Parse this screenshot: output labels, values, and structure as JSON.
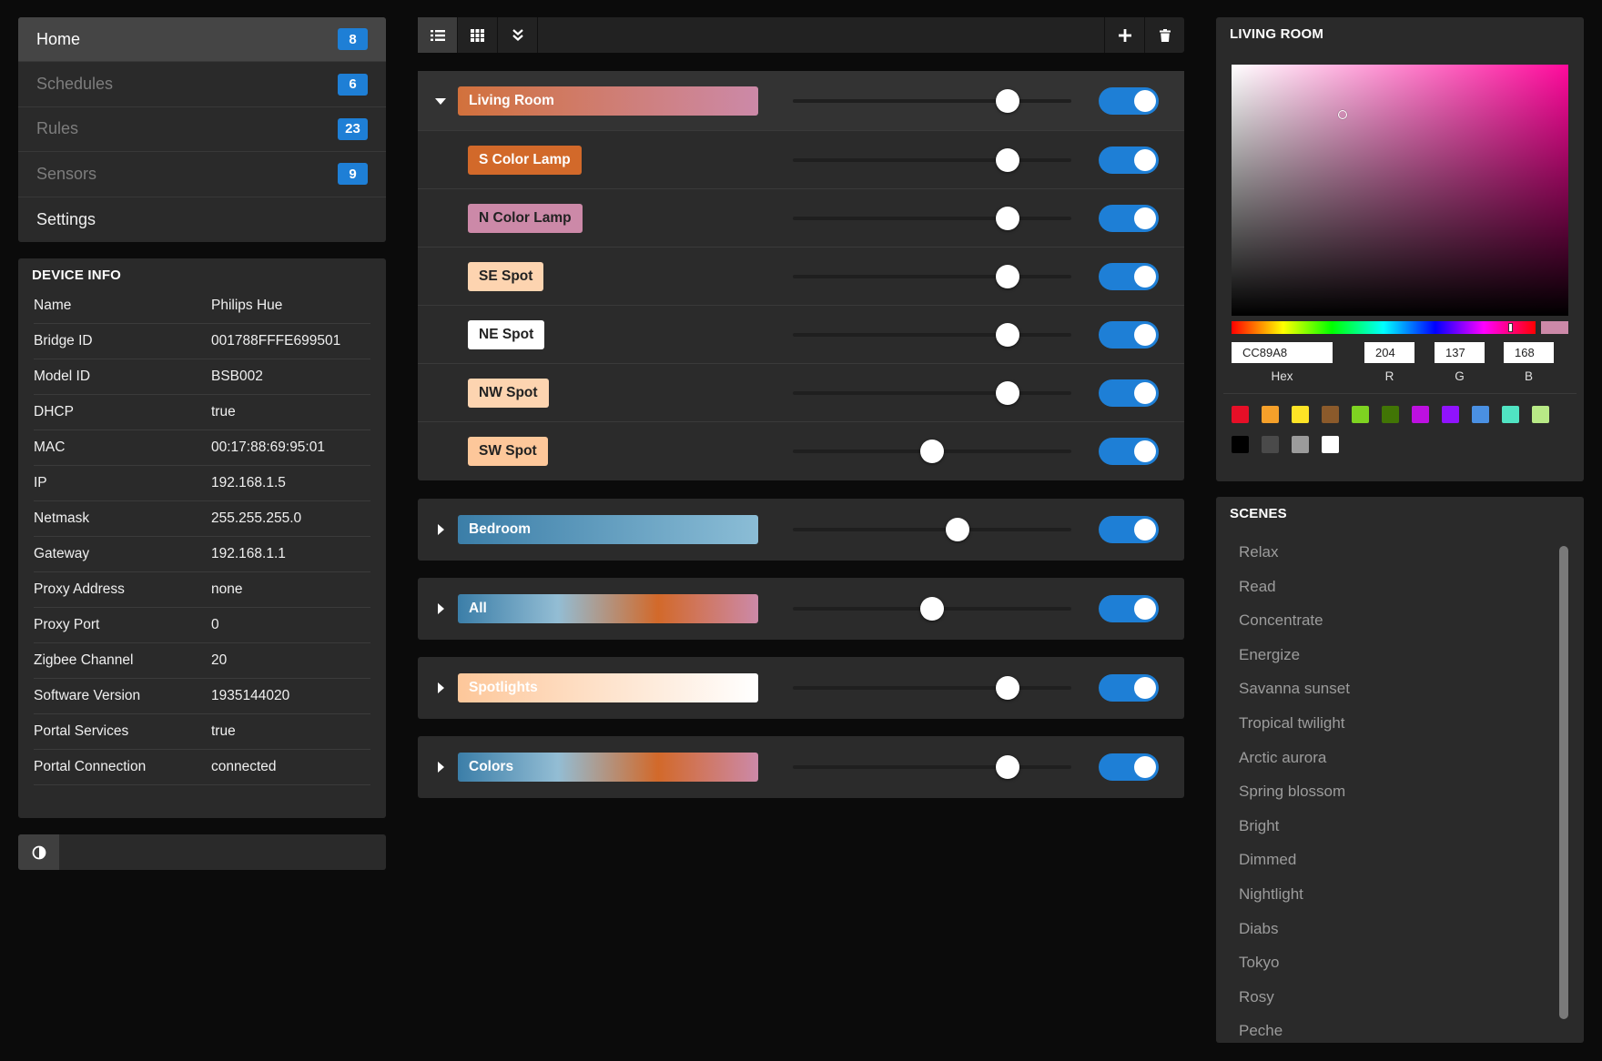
{
  "nav": {
    "items": [
      {
        "label": "Home",
        "badge": "8"
      },
      {
        "label": "Schedules",
        "badge": "6"
      },
      {
        "label": "Rules",
        "badge": "23"
      },
      {
        "label": "Sensors",
        "badge": "9"
      },
      {
        "label": "Settings"
      }
    ]
  },
  "device_info": {
    "title": "DEVICE INFO",
    "rows": [
      {
        "key": "Name",
        "value": "Philips Hue"
      },
      {
        "key": "Bridge ID",
        "value": "001788FFFE699501"
      },
      {
        "key": "Model ID",
        "value": "BSB002"
      },
      {
        "key": "DHCP",
        "value": "true"
      },
      {
        "key": "MAC",
        "value": "00:17:88:69:95:01"
      },
      {
        "key": "IP",
        "value": "192.168.1.5"
      },
      {
        "key": "Netmask",
        "value": "255.255.255.0"
      },
      {
        "key": "Gateway",
        "value": "192.168.1.1"
      },
      {
        "key": "Proxy Address",
        "value": "none"
      },
      {
        "key": "Proxy Port",
        "value": "0"
      },
      {
        "key": "Zigbee Channel",
        "value": "20"
      },
      {
        "key": "Software Version",
        "value": "1935144020"
      },
      {
        "key": "Portal Services",
        "value": "true"
      },
      {
        "key": "Portal Connection",
        "value": "connected"
      }
    ]
  },
  "groups": [
    {
      "name": "Living Room",
      "expanded": true,
      "brightness": 0.77,
      "on": true,
      "gradient": [
        "#d2713c",
        "#cc89a8"
      ],
      "lights": [
        {
          "name": "S Color Lamp",
          "brightness": 0.77,
          "on": true,
          "bg": "#d2692a",
          "fg": "#ffffff"
        },
        {
          "name": "N Color Lamp",
          "brightness": 0.77,
          "on": true,
          "bg": "#cc89a8",
          "fg": "#222222"
        },
        {
          "name": "SE Spot",
          "brightness": 0.77,
          "on": true,
          "bg": "#fdd4b0",
          "fg": "#222222"
        },
        {
          "name": "NE Spot",
          "brightness": 0.77,
          "on": true,
          "bg": "#ffffff",
          "fg": "#222222"
        },
        {
          "name": "NW Spot",
          "brightness": 0.77,
          "on": true,
          "bg": "#fdd4b0",
          "fg": "#222222"
        },
        {
          "name": "SW Spot",
          "brightness": 0.5,
          "on": true,
          "bg": "#fdc79a",
          "fg": "#222222"
        }
      ]
    },
    {
      "name": "Bedroom",
      "expanded": false,
      "brightness": 0.59,
      "on": true,
      "gradient": [
        "#3b7ea8",
        "#8bbdd6"
      ]
    },
    {
      "name": "All",
      "expanded": false,
      "brightness": 0.5,
      "on": true,
      "gradient": [
        "#3b7ea8",
        "#93bdd4",
        "#d2692a",
        "#cc89a8"
      ]
    },
    {
      "name": "Spotlights",
      "expanded": false,
      "brightness": 0.77,
      "on": true,
      "gradient": [
        "#fdc79a",
        "#ffffff"
      ]
    },
    {
      "name": "Colors",
      "expanded": false,
      "brightness": 0.77,
      "on": true,
      "gradient": [
        "#3b7ea8",
        "#93bdd4",
        "#d2692a",
        "#cc89a8"
      ]
    }
  ],
  "picker": {
    "title": "LIVING ROOM",
    "hex": "CC89A8",
    "r": "204",
    "g": "137",
    "b": "168",
    "labels": {
      "hex": "Hex",
      "r": "R",
      "g": "G",
      "b": "B"
    },
    "current_color": "#cc89a8",
    "hue_fraction": 0.915,
    "saturation": 0.33,
    "value": 0.8,
    "swatches": [
      "#e60f27",
      "#f5a02a",
      "#fde426",
      "#8b5a2b",
      "#7ed321",
      "#417505",
      "#bd10e0",
      "#9013fe",
      "#4a90e2",
      "#50e3c2",
      "#b8e986",
      "#000000",
      "#4a4a4a",
      "#9b9b9b",
      "#ffffff"
    ]
  },
  "scenes": {
    "title": "SCENES",
    "items": [
      "Relax",
      "Read",
      "Concentrate",
      "Energize",
      "Savanna sunset",
      "Tropical twilight",
      "Arctic aurora",
      "Spring blossom",
      "Bright",
      "Dimmed",
      "Nightlight",
      "Diabs",
      "Tokyo",
      "Rosy",
      "Peche"
    ]
  },
  "colors": {
    "accent": "#1e7fd6",
    "panel": "#2a2a2a",
    "background": "#0b0b0b"
  },
  "icons": {
    "toolbar": [
      "list-icon",
      "grid-icon",
      "expand-all-icon",
      "plus-icon",
      "trash-icon"
    ],
    "theme": "contrast-icon"
  }
}
